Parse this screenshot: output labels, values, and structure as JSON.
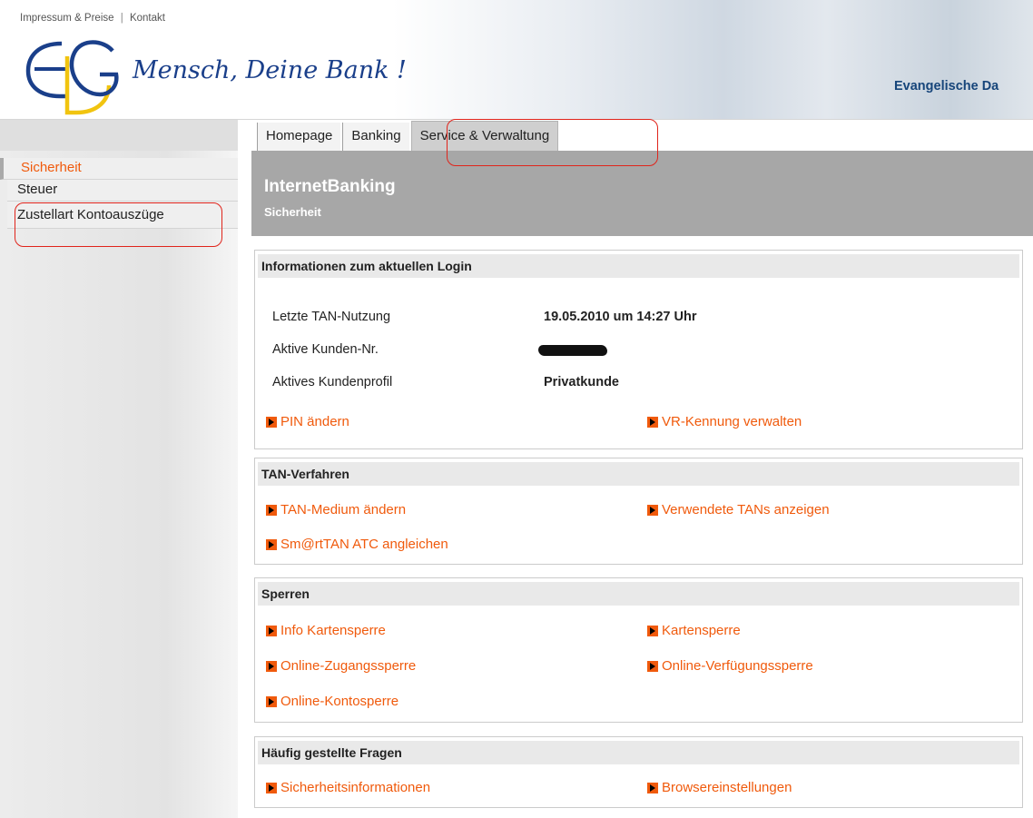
{
  "header": {
    "top_links": [
      "Impressum & Preise",
      "Kontakt"
    ],
    "logo_letters": "EDG",
    "slogan": "Mensch, Deine Bank !",
    "bank_name": "Evangelische Da"
  },
  "tabs": [
    {
      "label": "Homepage",
      "active": false
    },
    {
      "label": "Banking",
      "active": false
    },
    {
      "label": "Service & Verwaltung",
      "active": true
    }
  ],
  "sidebar": {
    "items": [
      {
        "label": "Sicherheit",
        "active": true
      },
      {
        "label": "Steuer",
        "active": false
      },
      {
        "label": "Zustellart Kontoauszüge",
        "active": false
      }
    ]
  },
  "title_band": {
    "title": "InternetBanking",
    "subtitle": "Sicherheit"
  },
  "login_box": {
    "heading": "Informationen zum aktuellen Login",
    "rows": [
      {
        "label": "Letzte TAN-Nutzung",
        "value": "19.05.2010 um 14:27 Uhr"
      },
      {
        "label": "Aktive Kunden-Nr.",
        "value": ""
      },
      {
        "label": "Aktives Kundenprofil",
        "value": "Privatkunde"
      }
    ],
    "links": [
      "PIN ändern",
      "VR-Kennung verwalten"
    ]
  },
  "tan_box": {
    "heading": "TAN-Verfahren",
    "links": [
      "TAN-Medium ändern",
      "Verwendete TANs anzeigen",
      "Sm@rtTAN ATC angleichen"
    ]
  },
  "sperren_box": {
    "heading": "Sperren",
    "links": [
      "Info Kartensperre",
      "Kartensperre",
      "Online-Zugangssperre",
      "Online-Verfügungssperre",
      "Online-Kontosperre"
    ]
  },
  "faq_box": {
    "heading": "Häufig gestellte Fragen",
    "links": [
      "Sicherheitsinformationen",
      "Browsereinstellungen"
    ]
  },
  "colors": {
    "accent_orange": "#f05a0c",
    "title_band_gray": "#a7a7a7",
    "annotation_red": "#e0241b",
    "bank_name_blue": "#16457a"
  }
}
